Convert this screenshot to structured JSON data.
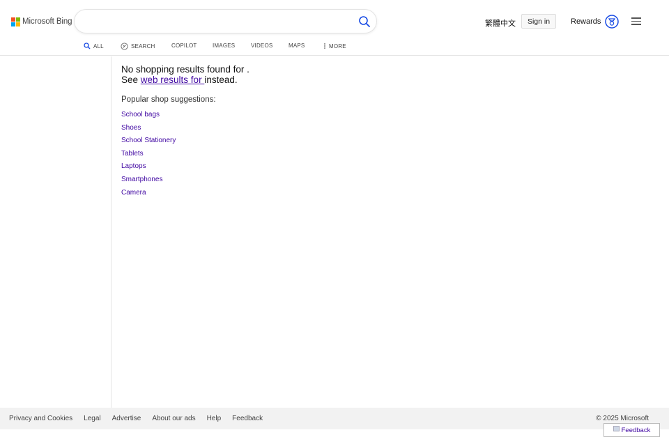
{
  "header": {
    "logo_text": "Microsoft Bing",
    "logo_colors": [
      "#f25022",
      "#7fba00",
      "#00a4ef",
      "#ffb900"
    ],
    "search": {
      "value": "",
      "placeholder": ""
    },
    "language_link": "繁體中文",
    "signin_label": "Sign in",
    "rewards_label": "Rewards",
    "accent_color": "#174ae4"
  },
  "nav": {
    "tabs": [
      {
        "label": "ALL",
        "icon": "search-icon"
      },
      {
        "label": "SEARCH",
        "icon": "copilot-search-icon"
      },
      {
        "label": "COPILOT"
      },
      {
        "label": "IMAGES"
      },
      {
        "label": "VIDEOS"
      },
      {
        "label": "MAPS"
      },
      {
        "label": "MORE",
        "icon": "more-dots-icon"
      }
    ]
  },
  "main": {
    "no_results_text": "No shopping results found for .",
    "see_prefix": "See ",
    "web_results_link": "web results for ",
    "see_suffix": "instead.",
    "popular_heading": "Popular shop suggestions:",
    "suggestions": [
      "School bags",
      "Shoes",
      "School Stationery",
      "Tablets",
      "Laptops",
      "Smartphones",
      "Camera"
    ],
    "link_color": "#4007a2"
  },
  "footer": {
    "links": [
      "Privacy and Cookies",
      "Legal",
      "Advertise",
      "About our ads",
      "Help",
      "Feedback"
    ],
    "copyright": "© 2025 Microsoft",
    "feedback_button": "Feedback"
  }
}
